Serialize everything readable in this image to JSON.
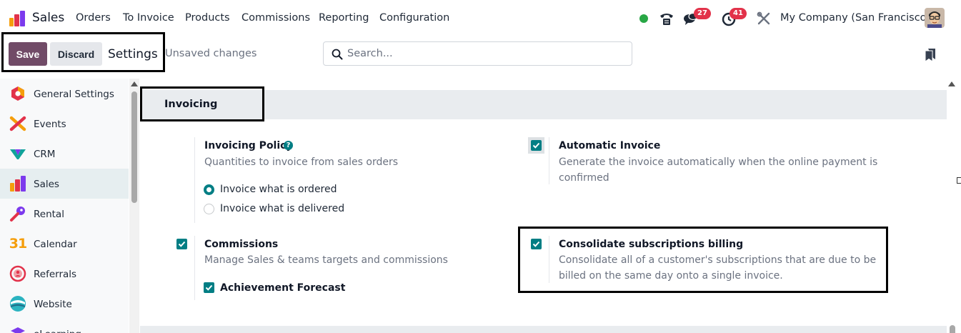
{
  "navbar": {
    "app_name": "Sales",
    "menu": [
      "Orders",
      "To Invoice",
      "Products",
      "Commissions",
      "Reporting",
      "Configuration"
    ],
    "messages_badge": "27",
    "activities_badge": "41",
    "company": "My Company (San Francisco)",
    "presence_color": "#28a745"
  },
  "control_panel": {
    "save_label": "Save",
    "discard_label": "Discard",
    "title": "Settings",
    "unsaved": "Unsaved changes",
    "search_placeholder": "Search..."
  },
  "sidebar": {
    "items": [
      {
        "label": "General Settings",
        "icon": "general-settings-icon"
      },
      {
        "label": "Events",
        "icon": "events-icon"
      },
      {
        "label": "CRM",
        "icon": "crm-icon"
      },
      {
        "label": "Sales",
        "icon": "sales-icon",
        "active": true
      },
      {
        "label": "Rental",
        "icon": "rental-icon"
      },
      {
        "label": "Calendar",
        "icon": "calendar-icon"
      },
      {
        "label": "Referrals",
        "icon": "referrals-icon"
      },
      {
        "label": "Website",
        "icon": "website-icon"
      },
      {
        "label": "eLearning",
        "icon": "elearning-icon"
      }
    ],
    "calendar_glyph": "31"
  },
  "section": {
    "title": "Invoicing",
    "invoicing_policy": {
      "title": "Invoicing Policy",
      "description": "Quantities to invoice from sales orders",
      "options": [
        {
          "label": "Invoice what is ordered",
          "selected": true
        },
        {
          "label": "Invoice what is delivered",
          "selected": false
        }
      ]
    },
    "automatic_invoice": {
      "title": "Automatic Invoice",
      "description_line1": "Generate the invoice automatically when the online payment is",
      "description_line2": "confirmed",
      "checked": true
    },
    "commissions": {
      "title": "Commissions",
      "description": "Manage Sales & teams targets and commissions",
      "checked": true,
      "sub_option": {
        "label": "Achievement Forecast",
        "checked": true
      }
    },
    "consolidate": {
      "title": "Consolidate subscriptions billing",
      "description_line1": "Consolidate all of a customer's subscriptions that are due to be",
      "description_line2": "billed on the same day onto a single invoice.",
      "checked": true
    }
  },
  "colors": {
    "primary": "#714b67",
    "accent": "#017e84",
    "badge": "#e2324a"
  }
}
